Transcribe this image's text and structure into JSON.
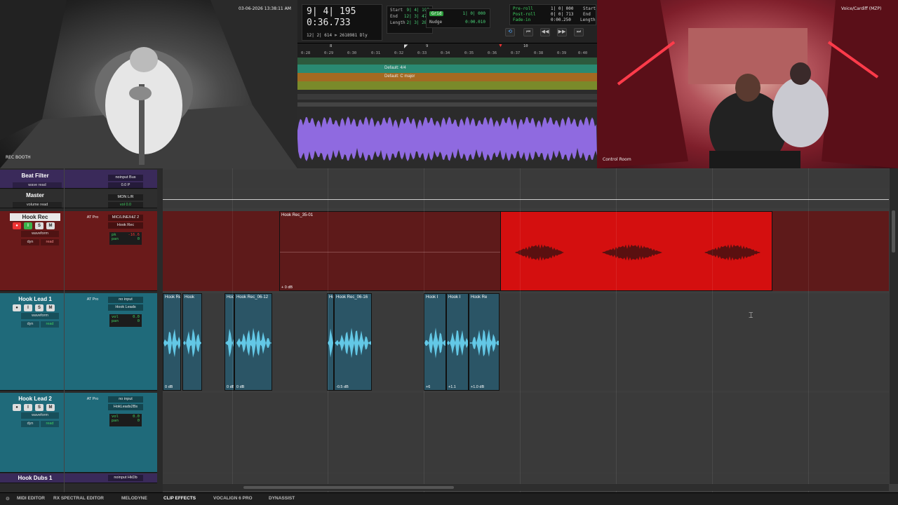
{
  "cameras": {
    "booth": {
      "label": "REC BOOTH",
      "timestamp": "03-06-2026 13:38:11 AM"
    },
    "control": {
      "label": "Control Room",
      "overlay": "Voice/Cardiff (MZP)"
    }
  },
  "transport": {
    "main_counter": "9| 4| 195",
    "sub_counter": "0:36.733",
    "small_counter_a": "12| 2| 614",
    "small_counter_b": "2618981",
    "small_counter_c": "Dly",
    "start_label": "Start",
    "start_value": "9| 4| 195",
    "end_label": "End",
    "end_value": "12| 3| 477",
    "length_label": "Length",
    "length_value": "2| 3| 282",
    "grid_label": "Grid",
    "grid_value": "1| 0| 000",
    "nudge_label": "Nudge",
    "nudge_value": "0:00.010",
    "preroll_label": "Pre-roll",
    "preroll_value": "1| 0| 000",
    "postroll_label": "Post-roll",
    "postroll_value": "0| 0| 713",
    "fadein_label": "Fade-in",
    "fadein_value": "0:00.250",
    "r_start_label": "Start",
    "r_end_label": "End",
    "r_length_label": "Length"
  },
  "ruler": {
    "bars": [
      "8",
      "9",
      "10"
    ],
    "ticks": [
      "0:28",
      "0:29",
      "0:30",
      "0:31",
      "0:32",
      "0:33",
      "0:34",
      "0:35",
      "0:36",
      "0:37",
      "0:38",
      "0:39",
      "0:40"
    ],
    "meter_text": "Default: 4/4",
    "key_text": "Default: C major"
  },
  "tracks": [
    {
      "name": "Beat Filter",
      "view": "wave",
      "read": "read",
      "io_top": "noinput",
      "io_bus": "Bus",
      "vol": "0.0",
      "pan": "P",
      "color": "#3a2a5a"
    },
    {
      "name": "Master",
      "view": "volume",
      "read": "read",
      "io_top": "MON L/R",
      "vol_label": "vol",
      "vol": "0.0",
      "color": "#2e2e2e"
    },
    {
      "name": "Hook Rec",
      "view": "waveform",
      "dyn": "dyn",
      "read": "read",
      "plug": "AT Pro",
      "io_in": "MIC/LINE/HiZ 2",
      "io_out": "Hook Rec",
      "pk_label": "pk",
      "pk": "-16.6",
      "pan_label": "pan",
      "pan": "0",
      "color": "#6a1a1a"
    },
    {
      "name": "Hook Lead 1",
      "view": "waveform",
      "dyn": "dyn",
      "read": "read",
      "plug": "AT Pro",
      "io_in": "no input",
      "io_out": "Hook Leads",
      "vol_label": "vol",
      "vol": "0.0",
      "pan_label": "pan",
      "pan": "0",
      "color": "#1f6a7a"
    },
    {
      "name": "Hook Lead 2",
      "view": "waveform",
      "dyn": "dyn",
      "read": "read",
      "plug": "AT Pro",
      "io_in": "no input",
      "io_out": "HokLeads2Bs",
      "vol_label": "vol",
      "vol": "0.0",
      "pan_label": "pan",
      "pan": "0",
      "color": "#1f6a7a"
    },
    {
      "name": "Hook Dubs 1",
      "io_top": "noinput",
      "io_bus": "HkDb",
      "color": "#3a2a5a"
    }
  ],
  "clips": {
    "hook_rec": {
      "name": "Hook Rec_35-01",
      "gain": "0 dB"
    },
    "lead1": [
      {
        "name": "Hook Re",
        "gain": "0 dB"
      },
      {
        "name": "Hook",
        "gain": ""
      },
      {
        "name": "Hook I",
        "gain": "0 dB"
      },
      {
        "name": "Hook Rec_06-12",
        "gain": "0 dB"
      },
      {
        "name": "Ho",
        "gain": ""
      },
      {
        "name": "Hook Rec_06-16",
        "gain": "-0.5 dB"
      },
      {
        "name": "Hook I",
        "gain": "+6"
      },
      {
        "name": "Hook I",
        "gain": "+1.1"
      },
      {
        "name": "Hook Re",
        "gain": "+1.0 dB"
      }
    ]
  },
  "bottom_tabs": [
    "MIDI EDITOR",
    "RX SPECTRAL EDITOR",
    "MELODYNE",
    "CLIP EFFECTS",
    "VOCALIGN 6 PRO",
    "DYNASSIST"
  ],
  "colors": {
    "hook_rec_clip": "#d40f0f",
    "hook_rec_lane": "#5e1a1a",
    "lead_clip": "#2b5566",
    "lead_wave": "#63c8e6",
    "mini_wave": "#8f6ae0"
  }
}
